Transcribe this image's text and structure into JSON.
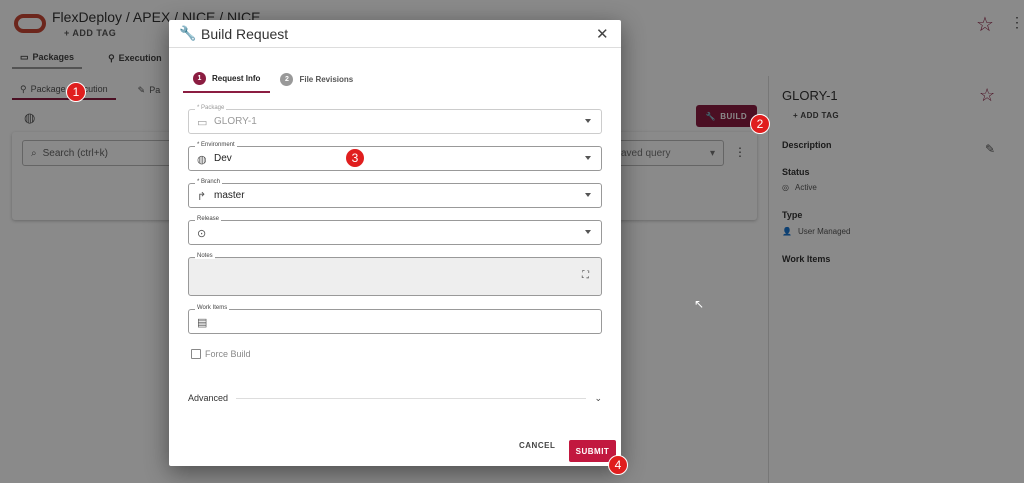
{
  "app": {
    "breadcrumb": "FlexDeploy / APEX / NICE / NICE",
    "add_tag": "+ ADD TAG",
    "star_icon": "star-outline-icon",
    "tabs": [
      {
        "label": "Packages",
        "icon": "package-icon"
      },
      {
        "label": "Execution",
        "icon": "run-icon"
      }
    ],
    "subtabs": [
      {
        "label": "Package Execution",
        "icon": "run-icon"
      },
      {
        "label": "Pa",
        "icon": "edit-icon"
      }
    ],
    "search_placeholder": "Search (ctrl+k)",
    "saved_query_placeholder": "aved query",
    "build_label": "BUILD",
    "accent_color": "#8b1d41"
  },
  "right_panel": {
    "title": "GLORY-1",
    "add_tag": "+ ADD TAG",
    "description_label": "Description",
    "status_label": "Status",
    "status_value": "Active",
    "type_label": "Type",
    "type_value": "User Managed",
    "work_items_label": "Work Items"
  },
  "dialog": {
    "title": "Build Request",
    "steps": [
      {
        "num": "1",
        "label": "Request Info"
      },
      {
        "num": "2",
        "label": "File Revisions"
      }
    ],
    "package_label": "* Package",
    "package_value": "GLORY-1",
    "environment_label": "* Environment",
    "environment_value": "Dev",
    "branch_label": "* Branch",
    "branch_value": "master",
    "release_label": "Release",
    "release_value": "",
    "notes_label": "Notes",
    "work_items_label": "Work Items",
    "force_build_label": "Force Build",
    "advanced_label": "Advanced",
    "cancel_label": "CANCEL",
    "submit_label": "SUBMIT",
    "submit_color": "#c2183f"
  },
  "callouts": [
    "1",
    "2",
    "3",
    "4"
  ]
}
